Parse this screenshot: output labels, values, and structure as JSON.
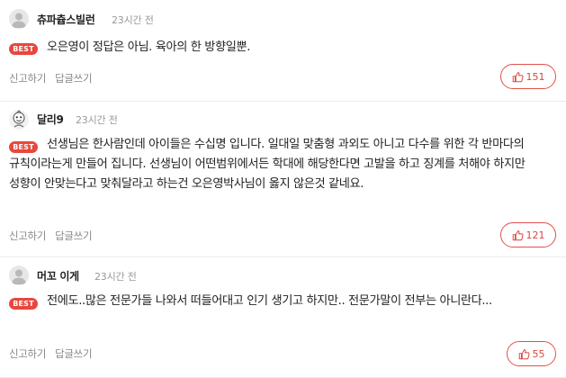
{
  "comments": [
    {
      "nickname": "츄파츕스빌런",
      "time": "23시간 전",
      "badge": "BEST",
      "text": "오은영이 정답은 아님. 육아의 한 방향일뿐.",
      "reply_label": "신고하기",
      "write_reply_label": "답글쓰기",
      "likes": "151",
      "avatar": "default-avatar"
    },
    {
      "nickname": "달리9",
      "time": "23시간 전",
      "badge": "BEST",
      "text": "선생님은 한사람인데 아이들은 수십명 입니다. 일대일 맞춤형 과외도 아니고 다수를 위한 각 반마다의 규칙이라는게 만들어 집니다. 선생님이 어떤범위에서든 학대에 해당한다면 고발을 하고 징계를 처해야 하지만 성향이 안맞는다고 맞춰달라고 하는건 오은영박사님이 옳지 않은것 같네요.",
      "reply_label": "신고하기",
      "write_reply_label": "답글쓰기",
      "likes": "121",
      "avatar": "character-avatar"
    },
    {
      "nickname": "머꼬 이게",
      "time": "23시간 전",
      "badge": "BEST",
      "text": "전에도..많은 전문가들 나와서 떠들어대고 인기 생기고 하지만.. 전문가말이 전부는 아니란다...",
      "reply_label": "신고하기",
      "write_reply_label": "답글쓰기",
      "likes": "55",
      "avatar": "default-avatar"
    }
  ],
  "colors": {
    "accent": "#e8473d",
    "muted": "#999999"
  },
  "icons": {
    "like": "thumbs-up-icon"
  }
}
